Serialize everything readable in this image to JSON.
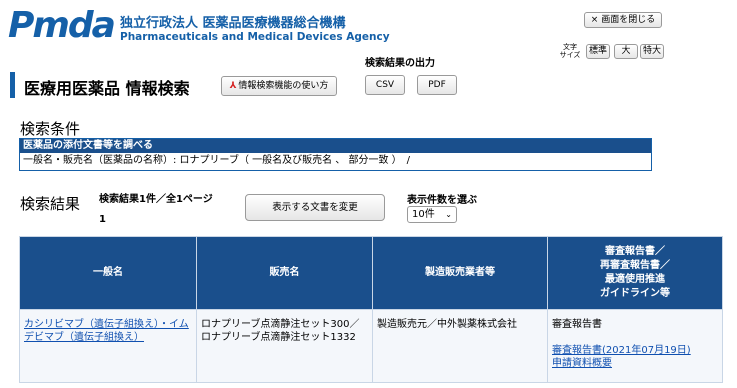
{
  "header": {
    "logo_text": "Pmda",
    "org_name_jp": "独立行政法人 医薬品医療機器総合機構",
    "org_name_en": "Pharmaceuticals and Medical Devices Agency",
    "close_button": "× 画面を閉じる",
    "font_size_label_1": "文字",
    "font_size_label_2": "サイズ",
    "font_size_options": [
      "標準",
      "大",
      "特大"
    ]
  },
  "page": {
    "title": "医療用医薬品 情報検索",
    "help_button": "情報検索機能の使い方",
    "help_button_icon": "pdf-icon",
    "export_label": "検索結果の出力",
    "export_csv": "CSV",
    "export_pdf": "PDF"
  },
  "conditions": {
    "heading": "検索条件",
    "box_title": "医薬品の添付文書等を調べる",
    "box_text": "一般名・販売名（医薬品の名称）: ロナプリーブ（ 一般名及び販売名 、 部分一致 ）　/"
  },
  "results": {
    "heading": "検索結果",
    "count_text": "検索結果1件／全1ページ",
    "page_number": "1",
    "change_docs_button": "表示する文書を変更",
    "per_page_label": "表示件数を選ぶ",
    "per_page_value": "10件",
    "table": {
      "headers": [
        "一般名",
        "販売名",
        "製造販売業者等",
        "審査報告書／\n再審査報告書／\n最適使用推進\nガイドライン等"
      ],
      "header_lines_4": [
        "審査報告書／",
        "再審査報告書／",
        "最適使用推進",
        "ガイドライン等"
      ],
      "rows": [
        {
          "generic_name": "カシリビマブ（遺伝子組換え）・イムデビマブ（遺伝子組換え）",
          "brand_name": "ロナプリーブ点滴静注セット300／ロナプリーブ点滴静注セット1332",
          "manufacturer": "製造販売元／中外製薬株式会社",
          "report_label": "審査報告書",
          "report_link": "審査報告書(2021年07月19日)",
          "report_link_2": "申請資料概要"
        }
      ]
    }
  },
  "colors": {
    "brand_blue": "#1560a8",
    "table_header": "#1a4f8c",
    "logo_accent": "#f08a00",
    "link": "#1050b0"
  }
}
